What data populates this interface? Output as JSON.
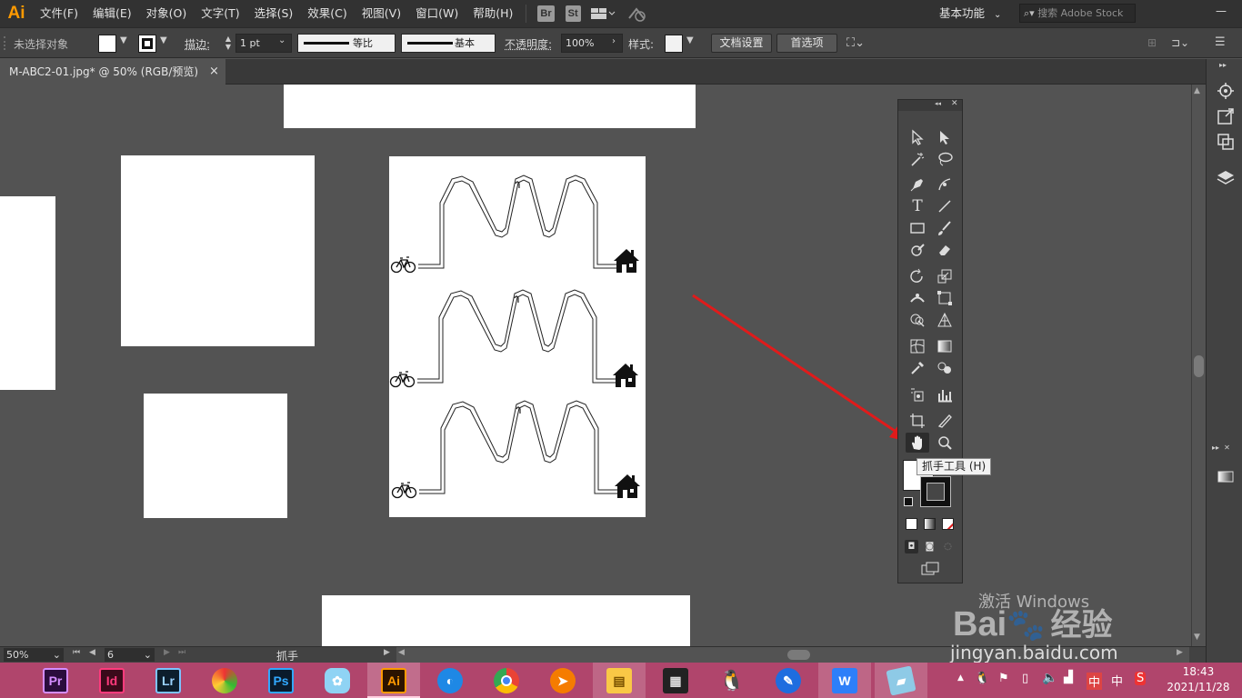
{
  "app": {
    "logo": "Ai",
    "menus": [
      "文件(F)",
      "编辑(E)",
      "对象(O)",
      "文字(T)",
      "选择(S)",
      "效果(C)",
      "视图(V)",
      "窗口(W)",
      "帮助(H)"
    ],
    "bridge_label": "Br",
    "stock_label": "St",
    "workspace": "基本功能",
    "search_placeholder": "搜索 Adobe Stock",
    "window_minimize": "—"
  },
  "control_bar": {
    "selection_status": "未选择对象",
    "stroke_label": "描边",
    "stroke_weight": "1 pt",
    "stroke_profile": "等比",
    "brush": "基本",
    "opacity_label": "不透明度",
    "opacity_value": "100%",
    "style_label": "样式",
    "doc_setup": "文档设置",
    "preferences": "首选项",
    "colon": ":"
  },
  "document": {
    "tab_title": "M-ABC2-01.jpg* @ 50% (RGB/预览)",
    "tab_close": "×"
  },
  "status_bar": {
    "zoom": "50%",
    "artboard_number": "6",
    "current_tool": "抓手"
  },
  "toolbox": {
    "tooltip": "抓手工具 (H)",
    "collapse": "◂◂",
    "close": "✕"
  },
  "taskbar": {
    "apps": [
      "Pr",
      "Id",
      "Lr",
      "",
      "Ps",
      "",
      "Ai",
      "",
      "",
      "",
      "",
      "",
      "",
      "",
      "",
      "",
      ""
    ],
    "time": "18:43",
    "date": "2021/11/28",
    "ime": "中"
  },
  "watermark": {
    "activate_windows": "激活 Windows",
    "baidu": "Bai",
    "jingyan": "经验",
    "url": "jingyan.baidu.com"
  },
  "colors": {
    "accent_arrow": "#e01b1b",
    "taskbar": "#b0456c",
    "ai_orange": "#ff9a00"
  }
}
